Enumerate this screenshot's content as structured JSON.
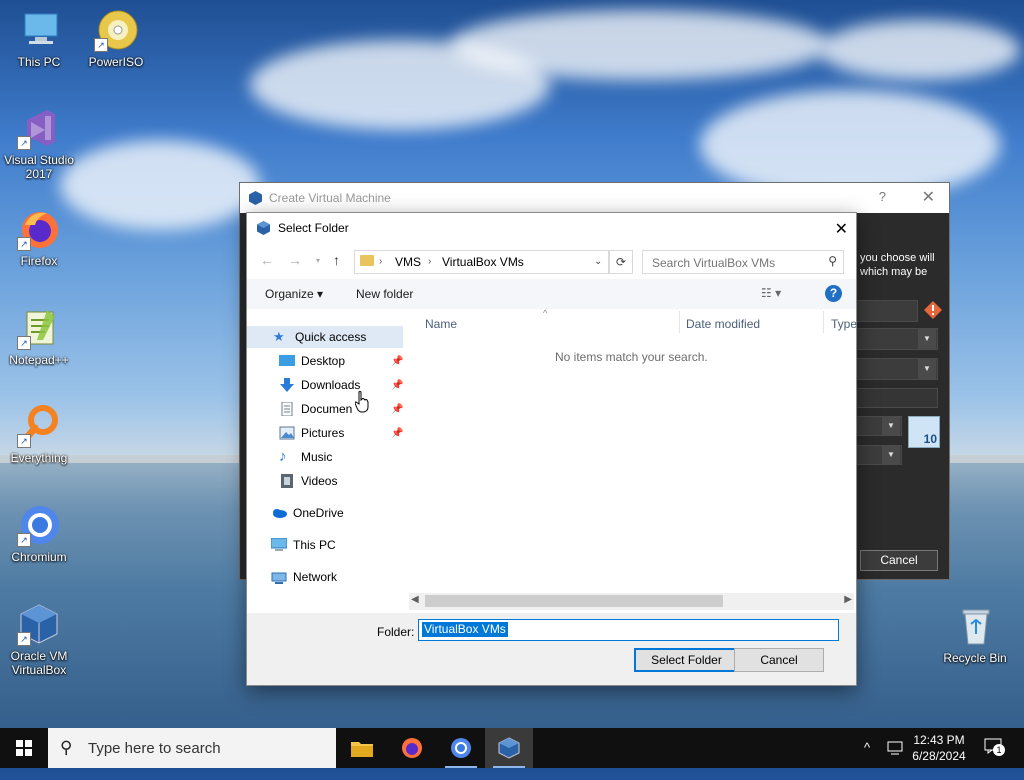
{
  "desktop": {
    "icons": [
      {
        "label": "This PC",
        "icon": "computer-icon"
      },
      {
        "label": "PowerISO",
        "icon": "disc-icon"
      },
      {
        "label": "Visual Studio 2017",
        "icon": "visual-studio-icon"
      },
      {
        "label": "Firefox",
        "icon": "firefox-icon"
      },
      {
        "label": "Notepad++",
        "icon": "notepad-icon"
      },
      {
        "label": "Everything",
        "icon": "magnifier-icon"
      },
      {
        "label": "Chromium",
        "icon": "chromium-icon"
      },
      {
        "label": "Oracle VM VirtualBox",
        "icon": "virtualbox-icon"
      },
      {
        "label": "Recycle Bin",
        "icon": "recycle-bin-icon"
      }
    ]
  },
  "vm_dialog": {
    "title": "Create Virtual Machine",
    "help": "?",
    "close": "✕",
    "text_line1": "you choose will",
    "text_line2": "which may be",
    "os_badge": "10",
    "cancel": "Cancel"
  },
  "select_folder": {
    "title": "Select Folder",
    "close": "✕",
    "breadcrumb": [
      "VMS",
      "VirtualBox VMs"
    ],
    "search_placeholder": "Search VirtualBox VMs",
    "toolbar": {
      "organize": "Organize ▾",
      "new_folder": "New folder",
      "help": "?"
    },
    "nav": {
      "quick_access": "Quick access",
      "items": [
        "Desktop",
        "Downloads",
        "Documen",
        "Pictures",
        "Music",
        "Videos"
      ],
      "onedrive": "OneDrive",
      "this_pc": "This PC",
      "network": "Network"
    },
    "columns": [
      "Name",
      "Date modified",
      "Type"
    ],
    "empty_message": "No items match your search.",
    "folder_label": "Folder:",
    "folder_value": "VirtualBox VMs",
    "select_button": "Select Folder",
    "cancel_button": "Cancel"
  },
  "taskbar": {
    "search_placeholder": "Type here to search",
    "time": "12:43 PM",
    "date": "6/28/2024",
    "notification_count": "1",
    "tray_chevron": "^"
  },
  "colors": {
    "accent": "#0078d7",
    "vm_dark": "#2b2b2b",
    "taskbar": "#101010"
  }
}
